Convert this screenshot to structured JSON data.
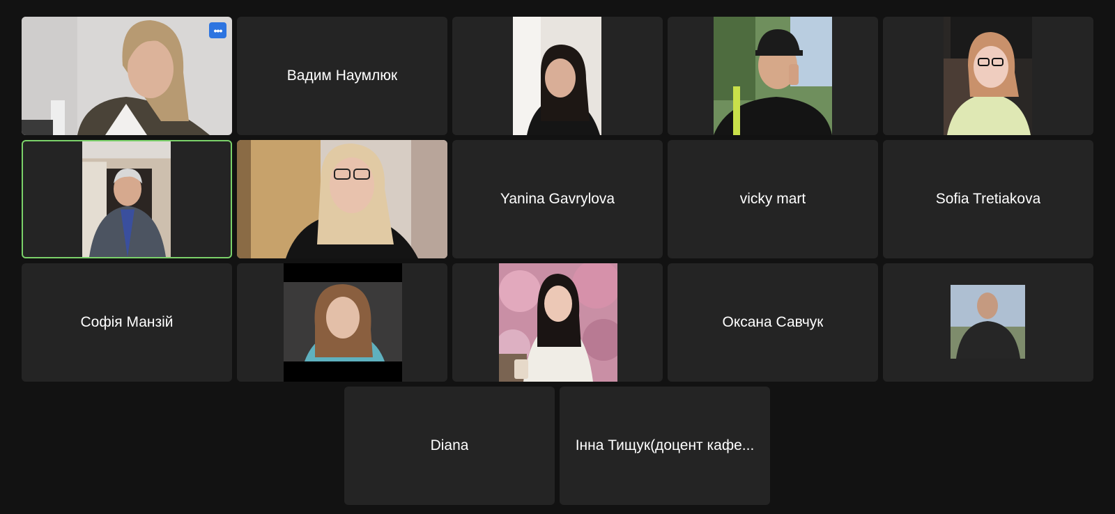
{
  "meeting": {
    "view": "gallery",
    "participants": [
      {
        "id": "p1",
        "name": "",
        "video_on": true,
        "has_more_menu": true
      },
      {
        "id": "p2",
        "name": "Вадим Наумлюк",
        "video_on": false
      },
      {
        "id": "p3",
        "name": "",
        "video_on": true
      },
      {
        "id": "p4",
        "name": "",
        "video_on": true
      },
      {
        "id": "p5",
        "name": "",
        "video_on": true
      },
      {
        "id": "p6",
        "name": "",
        "video_on": true,
        "active_speaker": true
      },
      {
        "id": "p7",
        "name": "",
        "video_on": true
      },
      {
        "id": "p8",
        "name": "Yanina Gavrylova",
        "video_on": false
      },
      {
        "id": "p9",
        "name": "vicky mart",
        "video_on": false
      },
      {
        "id": "p10",
        "name": "Sofia Tretiakova",
        "video_on": false
      },
      {
        "id": "p11",
        "name": "Софія Манзій",
        "video_on": false
      },
      {
        "id": "p12",
        "name": "",
        "video_on": true
      },
      {
        "id": "p13",
        "name": "",
        "video_on": true
      },
      {
        "id": "p14",
        "name": "Оксана Савчук",
        "video_on": false
      },
      {
        "id": "p15",
        "name": "",
        "video_on": true
      },
      {
        "id": "p16",
        "name": "Diana",
        "video_on": false
      },
      {
        "id": "p17",
        "name": "Інна Тищук(доцент кафе...",
        "video_on": false
      }
    ],
    "more_menu_label": "•••",
    "active_speaker_color": "#7bd26a",
    "accent_color": "#2d74e0"
  }
}
